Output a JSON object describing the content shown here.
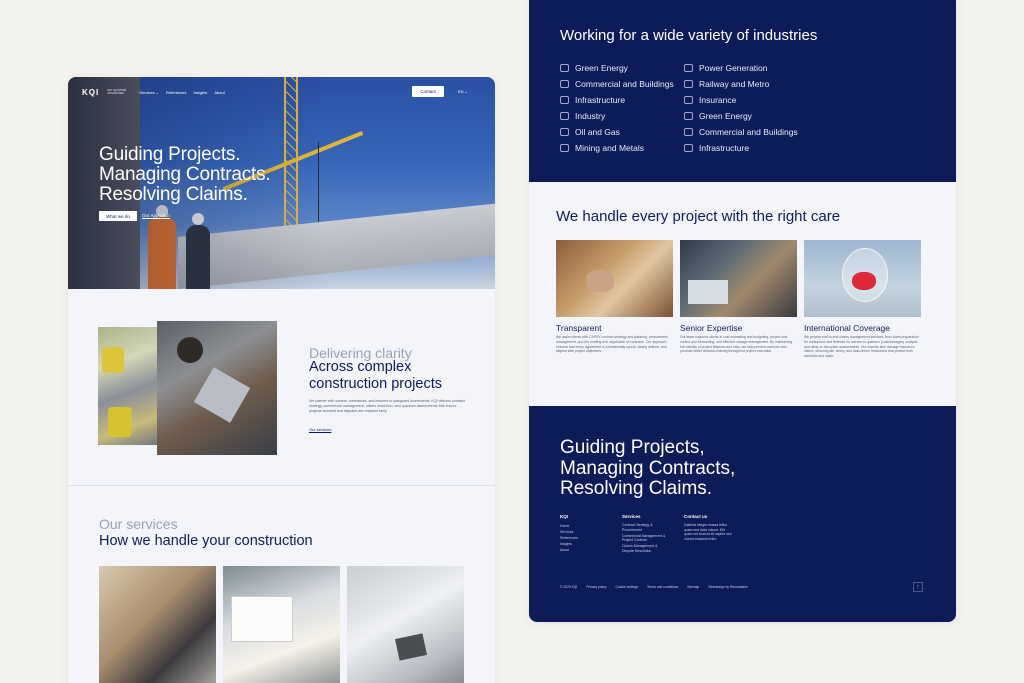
{
  "left_page": {
    "nav": {
      "logo": "KQI",
      "logo_sub": "KEY QUANTUM INTEGRATED",
      "links": [
        "Services ⌄",
        "References",
        "Insights",
        "About"
      ],
      "contact_label": "Contact",
      "lang_label": "EN ⌄"
    },
    "hero": {
      "title_lines": [
        "Guiding Projects.",
        "Managing Contracts.",
        "Resolving Claims."
      ],
      "primary_button": "What we do",
      "secondary_link": "Our Approach"
    },
    "clarity": {
      "subtitle": "Delivering clarity",
      "title": "Across complex construction projects",
      "body": "We partner with owners, contractors, and insurers to safeguard investments. KQI delivers contract strategy, commercial management, claims resolution, and quantum assessments that ensure projects succeed and disputes are resolved fairly.",
      "link": "Our services"
    },
    "services": {
      "subtitle": "Our services",
      "title": "How we handle your construction"
    }
  },
  "right_page": {
    "industries": {
      "title": "Working for a wide variety of industries",
      "col1": [
        {
          "label": "Green Energy",
          "icon": "leaf-icon"
        },
        {
          "label": "Commercial and Buildings",
          "icon": "building-icon"
        },
        {
          "label": "Infrastructure",
          "icon": "bridge-icon"
        },
        {
          "label": "Industry",
          "icon": "factory-icon"
        },
        {
          "label": "Oil and Gas",
          "icon": "drop-icon"
        },
        {
          "label": "Mining and Metals",
          "icon": "mine-cart-icon"
        }
      ],
      "col2": [
        {
          "label": "Power Generation",
          "icon": "bolt-icon"
        },
        {
          "label": "Railway and Metro",
          "icon": "train-icon"
        },
        {
          "label": "Insurance",
          "icon": "shield-icon"
        },
        {
          "label": "Green Energy",
          "icon": "leaf-icon"
        },
        {
          "label": "Commercial and Buildings",
          "icon": "building-icon"
        },
        {
          "label": "Infrastructure",
          "icon": "bridge-icon"
        }
      ]
    },
    "care": {
      "title": "We handle every project with the right care",
      "cards": [
        {
          "heading": "Transparent",
          "body": "We assist clients with CAPEX contract strategy and planning, procurement management, and the drafting and negotiation of contracts. Our approach ensures that every agreement is commercially sound, clearly defined, and aligned with project objectives."
        },
        {
          "heading": "Senior Expertise",
          "body": "Our team supports clients in cost estimating and budgeting, project cost control and forecasting, and effective change management. By maintaining full visibility of project finances and risks, we help prevent overruns and promote better decision-making throughout project execution."
        },
        {
          "heading": "International Coverage",
          "body": "We provide end-to-end claims management services, from claim preparation for contractors and defense for owners to quantum (cost/damages) analysis and delay or disruption assessments. Our experts also manage insurance claims, ensuring fair, timely, and data-driven resolutions that protect both schedule and value."
        }
      ]
    },
    "footer": {
      "title_lines": [
        "Guiding Projects,",
        "Managing Contracts,",
        "Resolving Claims."
      ],
      "col_kqi": {
        "heading": "KQI",
        "links": [
          "Home",
          "Services",
          "References",
          "Insights",
          "About"
        ]
      },
      "col_services": {
        "heading": "Services",
        "links": [
          "Contract Strategy & Procurement",
          "Commercial Management & Project Controls",
          "Claims Management & Dispute Resolution"
        ]
      },
      "col_contact": {
        "heading": "Contact us",
        "text": "Datteria integer massa tellus quam sed dolor rutrum. Elit quam vel ecorcet sit sapien sed viverra tincidunt enim."
      },
      "bottom_links": [
        "© 2025 KQI",
        "Privacy policy",
        "Cookie settings",
        "Terms and conditions",
        "Sitemap",
        "Webdesign by Remarkable"
      ],
      "back_to_top": "↑"
    }
  }
}
